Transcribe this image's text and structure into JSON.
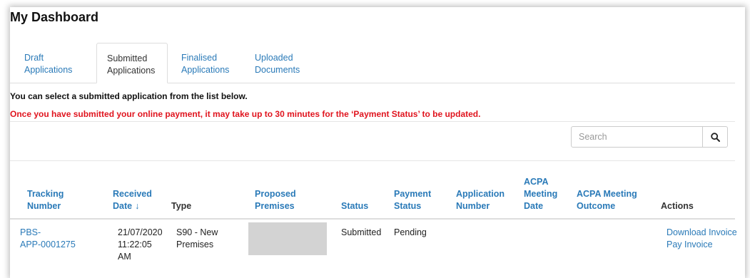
{
  "page_title": "My Dashboard",
  "tabs": [
    {
      "line1": "Draft",
      "line2": "Applications",
      "active": false
    },
    {
      "line1": "Submitted",
      "line2": "Applications",
      "active": true
    },
    {
      "line1": "Finalised",
      "line2": "Applications",
      "active": false
    },
    {
      "line1": "Uploaded",
      "line2": "Documents",
      "active": false
    }
  ],
  "info_text": "You can select a submitted application from the list below.",
  "payment_notice": "Once you have submitted your online payment, it may take up to 30 minutes for the ‘Payment Status’ to be updated.",
  "search": {
    "placeholder": "Search"
  },
  "columns": {
    "tracking": [
      "Tracking",
      "Number"
    ],
    "received": [
      "Received",
      "Date"
    ],
    "received_sort": "↓",
    "type": [
      "Type"
    ],
    "premises": [
      "Proposed",
      "Premises"
    ],
    "status": [
      "Status"
    ],
    "payment": [
      "Payment",
      "Status"
    ],
    "appnum": [
      "Application",
      "Number"
    ],
    "acpa_date": [
      "ACPA",
      "Meeting",
      "Date"
    ],
    "acpa_outcome": [
      "ACPA Meeting",
      "Outcome"
    ],
    "actions": [
      "Actions"
    ]
  },
  "rows": [
    {
      "tracking": [
        "PBS-",
        "APP-0001275"
      ],
      "received": [
        "21/07/2020",
        "11:22:05",
        "AM"
      ],
      "type": [
        "S90 - New",
        "Premises"
      ],
      "status": "Submitted",
      "payment": "Pending",
      "actions": {
        "download": "Download Invoice",
        "pay": "Pay Invoice"
      }
    }
  ]
}
